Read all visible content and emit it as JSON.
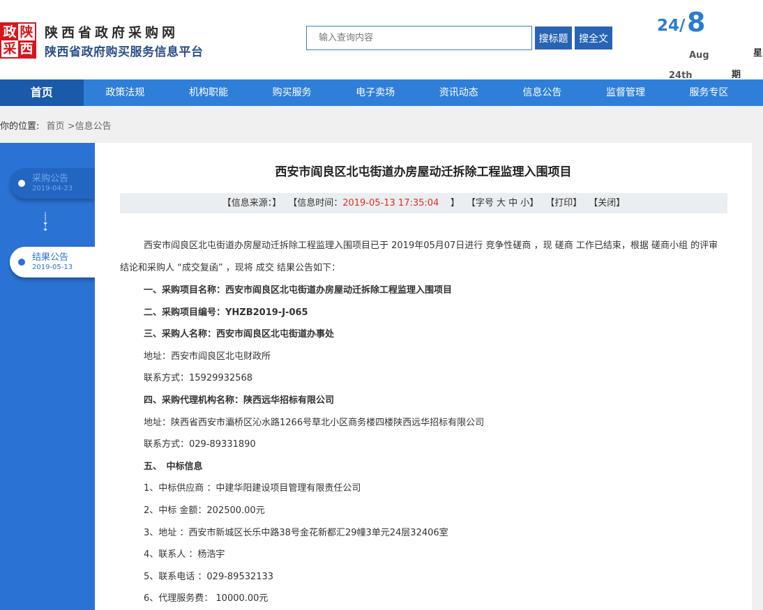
{
  "header": {
    "logo_chars": [
      "政",
      "陕",
      "采",
      "西"
    ],
    "site_title": "陕西省政府采购网",
    "site_subtitle": "陕西省政府购买服务信息平台",
    "search_placeholder": "输入查询内容",
    "btn_search_title": "搜标题",
    "btn_search_full": "搜全文",
    "date_day": "24/",
    "date_month_num": "8",
    "date_month": "Aug",
    "date_th": "24th",
    "week_1": "星",
    "week_2": "期"
  },
  "nav": {
    "items": [
      "首页",
      "政策法规",
      "机构职能",
      "购买服务",
      "电子卖场",
      "资讯动态",
      "信息公告",
      "监督管理",
      "服务专区"
    ]
  },
  "breadcrumb": {
    "label": "你的位置:",
    "home": "首页",
    "current": ">信息公告"
  },
  "sidebar": {
    "items": [
      {
        "label": "采购公告",
        "date": "2019-04-23"
      },
      {
        "label": "结果公告",
        "date": "2019-05-13"
      }
    ],
    "arrow": "⇣"
  },
  "article": {
    "title": "西安市阎良区北屯街道办房屋动迁拆除工程监理入围项目",
    "meta_source": "【信息来源：】",
    "meta_time_label": "【信息时间：",
    "meta_time": "2019-05-13 17:35:04",
    "meta_time_end": "】",
    "meta_font": "【字号 大 中 小】",
    "meta_print": "【打印】",
    "meta_close": "【关闭】",
    "intro_line1": "西安市阎良区北屯街道办房屋动迁拆除工程监理入围项目已于 2019年05月07日进行 竞争性磋商 ，现 磋商 工作已结束，根据 磋商小组 的评审",
    "intro_line2": "结论和采购人 “成交复函” ，现将 成交 结果公告如下：",
    "lines": [
      {
        "text": "一、采购项目名称：西安市阎良区北屯街道办房屋动迁拆除工程监理入围项目",
        "bold": true
      },
      {
        "text": "二、采购项目编号：YHZB2019-J-065",
        "bold": true
      },
      {
        "text": "三、采购人名称：西安市阎良区北屯街道办事处",
        "bold": true
      },
      {
        "text": "地址：西安市阎良区北屯财政所",
        "bold": false
      },
      {
        "text": "联系方式：15929932568",
        "bold": false
      },
      {
        "text": "四、采购代理机构名称：陕西远华招标有限公司",
        "bold": true
      },
      {
        "text": "地址：陕西省西安市灞桥区沁水路1266号草北小区商务楼四楼陕西远华招标有限公司",
        "bold": false
      },
      {
        "text": "联系方式：029-89331890",
        "bold": false
      },
      {
        "text": "五、　中标信息",
        "bold": true
      },
      {
        "text": "1、中标供应商 ：中建华阳建设项目管理有限责任公司",
        "bold": false
      },
      {
        "text": "2、中标 金额：202500.00元",
        "bold": false
      },
      {
        "text": "3、地址 ：西安市新城区长乐中路38号金花新都汇29幢3单元24层32406室",
        "bold": false
      },
      {
        "text": "4、联系人 ：杨浩宇",
        "bold": false
      },
      {
        "text": "5、联系电话 ：029-89532133",
        "bold": false
      },
      {
        "text": "6、代理服务费： 10000.00元",
        "bold": false
      }
    ]
  },
  "colors": {
    "nav_bg": "#2f7fd9",
    "nav_active": "#1b5aaa",
    "logo_red": "#d7161c",
    "sidebar_bg": "#2a72d4",
    "time_red": "#e0301e"
  }
}
